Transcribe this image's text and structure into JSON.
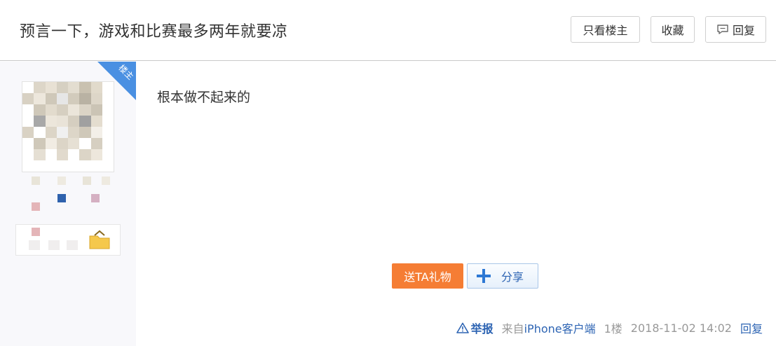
{
  "thread": {
    "title": "预言一下，游戏和比赛最多两年就要凉"
  },
  "toolbar": {
    "only_author_label": "只看楼主",
    "favorite_label": "收藏",
    "reply_label": "回复"
  },
  "post": {
    "author_tag": "楼主",
    "content": "根本做不起来的",
    "gift_label": "送TA礼物",
    "share_label": "分享",
    "report_label": "举报",
    "source_prefix": "来自",
    "source_client": "iPhone客户端",
    "floor": "1楼",
    "timestamp": "2018-11-02 14:02",
    "reply_label": "回复"
  },
  "icons": {
    "reply": "speech-bubble-icon",
    "share": "plus-icon",
    "report": "warning-triangle-icon",
    "badge": "folder-icon"
  },
  "colors": {
    "accent_blue": "#2d64b3",
    "gift_orange": "#f57d34",
    "author_tag_blue": "#4a90e2"
  }
}
